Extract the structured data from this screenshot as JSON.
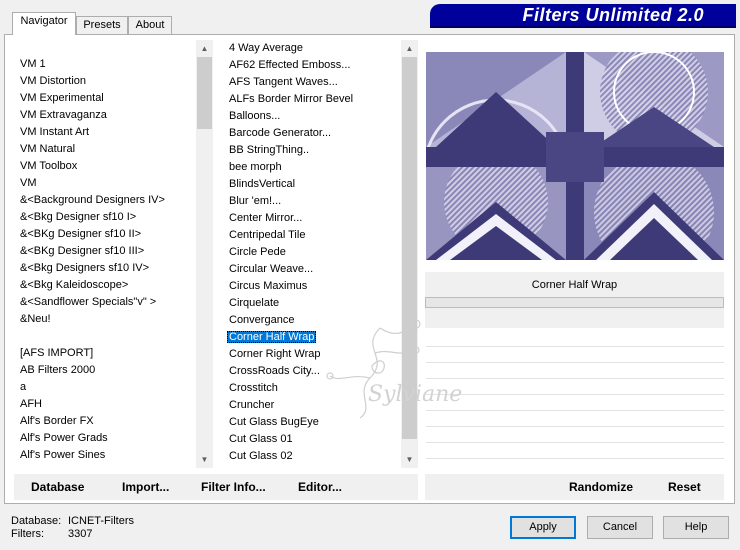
{
  "title": "Filters Unlimited 2.0",
  "tabs": [
    {
      "label": "Navigator",
      "active": true
    },
    {
      "label": "Presets",
      "active": false
    },
    {
      "label": "About",
      "active": false
    }
  ],
  "categories": [
    "VM 1",
    "VM Distortion",
    "VM Experimental",
    "VM Extravaganza",
    "VM Instant Art",
    "VM Natural",
    "VM Toolbox",
    "VM",
    "&<Background Designers IV>",
    "&<Bkg Designer sf10 I>",
    "&<BKg Designer sf10 II>",
    "&<BKg Designer sf10 III>",
    "&<Bkg Designers sf10 IV>",
    "&<Bkg Kaleidoscope>",
    "&<Sandflower Specials\"v\" >",
    "&Neu!",
    "",
    "[AFS IMPORT]",
    "AB Filters 2000",
    "a",
    "AFH",
    "Alf's Border FX",
    "Alf's Power Grads",
    "Alf's Power Sines"
  ],
  "filters": [
    "4 Way Average",
    "AF62 Effected Emboss...",
    "AFS Tangent Waves...",
    "ALFs Border Mirror Bevel",
    "Balloons...",
    "Barcode Generator...",
    "BB StringThing..",
    "bee morph",
    "BlindsVertical",
    "Blur 'em!...",
    "Center Mirror...",
    "Centripedal Tile",
    "Circle Pede",
    "Circular Weave...",
    "Circus Maximus",
    "Cirquelate",
    "Convergance",
    "Corner Half Wrap",
    "Corner Right Wrap",
    "CrossRoads City...",
    "Crosstitch",
    "Cruncher",
    "Cut Glass  BugEye",
    "Cut Glass 01",
    "Cut Glass 02"
  ],
  "selected_filter_index": 17,
  "selected_filter_name": "Corner Half Wrap",
  "buttons": {
    "database": "Database",
    "import": "Import...",
    "filter_info": "Filter Info...",
    "editor": "Editor...",
    "randomize": "Randomize",
    "reset": "Reset",
    "apply": "Apply",
    "cancel": "Cancel",
    "help": "Help"
  },
  "status": {
    "database_label": "Database:",
    "database_value": "ICNET-Filters",
    "filters_label": "Filters:",
    "filters_value": "3307"
  },
  "watermark": "Sylviane",
  "colors": {
    "banner": "#00009a",
    "selection": "#0078d7",
    "preview_dark": "#3e3a78",
    "preview_light": "#c8c6e0"
  }
}
